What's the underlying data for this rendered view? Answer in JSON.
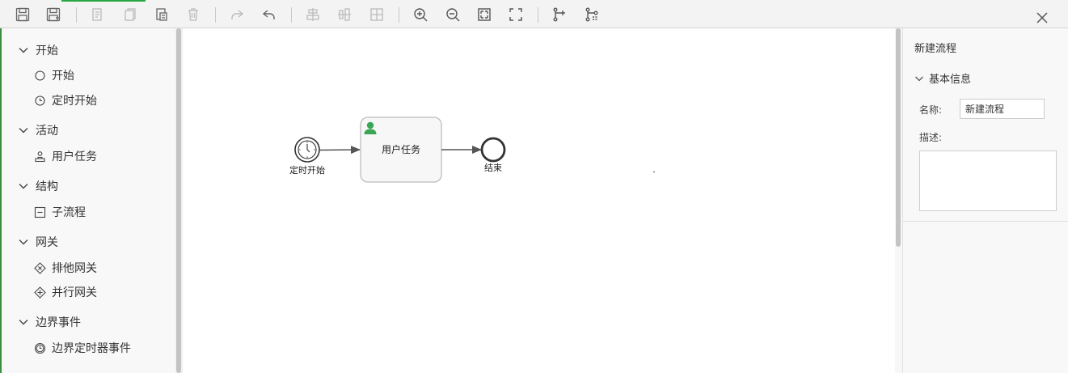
{
  "toolbar": {
    "buttons": [
      {
        "name": "save-icon"
      },
      {
        "name": "save-as-icon"
      },
      {
        "name": "cut-icon"
      },
      {
        "name": "copy-icon"
      },
      {
        "name": "paste-icon"
      },
      {
        "name": "delete-icon"
      },
      {
        "name": "redo-icon"
      },
      {
        "name": "undo-icon"
      },
      {
        "name": "align-horizontal-icon"
      },
      {
        "name": "align-vertical-icon"
      },
      {
        "name": "distribute-icon"
      },
      {
        "name": "zoom-in-icon"
      },
      {
        "name": "zoom-out-icon"
      },
      {
        "name": "fit-screen-icon"
      },
      {
        "name": "actual-size-icon"
      },
      {
        "name": "add-flow-icon"
      },
      {
        "name": "flow-settings-icon"
      }
    ],
    "close_icon": "close-icon"
  },
  "palette": {
    "groups": [
      {
        "label": "开始",
        "items": [
          {
            "label": "开始",
            "icon": "circle-icon"
          },
          {
            "label": "定时开始",
            "icon": "clock-icon"
          }
        ]
      },
      {
        "label": "活动",
        "items": [
          {
            "label": "用户任务",
            "icon": "user-task-icon"
          }
        ]
      },
      {
        "label": "结构",
        "items": [
          {
            "label": "子流程",
            "icon": "subprocess-icon"
          }
        ]
      },
      {
        "label": "网关",
        "items": [
          {
            "label": "排他网关",
            "icon": "exclusive-gateway-icon"
          },
          {
            "label": "并行网关",
            "icon": "parallel-gateway-icon"
          }
        ]
      },
      {
        "label": "边界事件",
        "items": [
          {
            "label": "边界定时器事件",
            "icon": "boundary-timer-icon"
          }
        ]
      }
    ]
  },
  "diagram": {
    "start_label": "定时开始",
    "task_label": "用户任务",
    "end_label": "结束"
  },
  "properties": {
    "title": "新建流程",
    "section": "基本信息",
    "name_label": "名称:",
    "name_value": "新建流程",
    "desc_label": "描述:"
  },
  "colors": {
    "accent": "#27a844",
    "user_icon": "#3aa655"
  }
}
